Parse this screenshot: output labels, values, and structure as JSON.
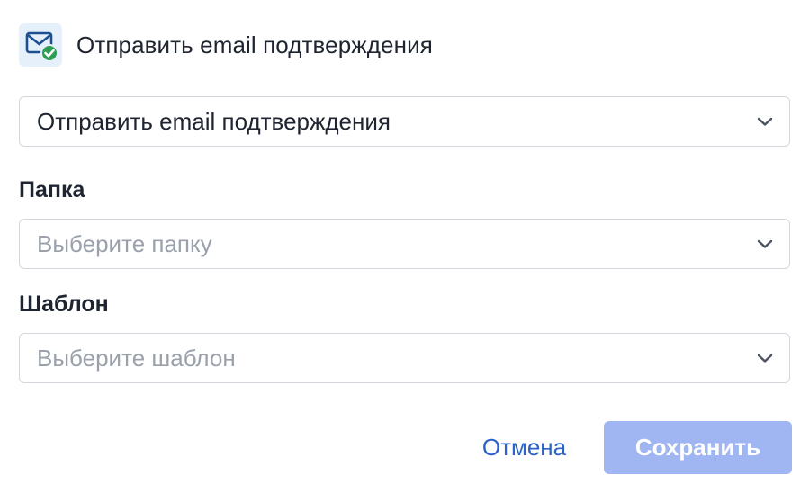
{
  "header": {
    "icon": "mail-check-icon",
    "title": "Отправить email подтверждения"
  },
  "action_select": {
    "value": "Отправить email подтверждения",
    "icon": "chevron-down-icon"
  },
  "folder": {
    "label": "Папка",
    "placeholder": "Выберите папку",
    "icon": "chevron-down-icon"
  },
  "template": {
    "label": "Шаблон",
    "placeholder": "Выберите шаблон",
    "icon": "chevron-down-icon"
  },
  "footer": {
    "cancel_label": "Отмена",
    "save_label": "Сохранить"
  },
  "colors": {
    "accent": "#2d62c8",
    "save_disabled_bg": "#a0b6f2",
    "icon_bg": "#e6f0fb",
    "check_green": "#2e9e52",
    "border": "#d3d7dd"
  }
}
